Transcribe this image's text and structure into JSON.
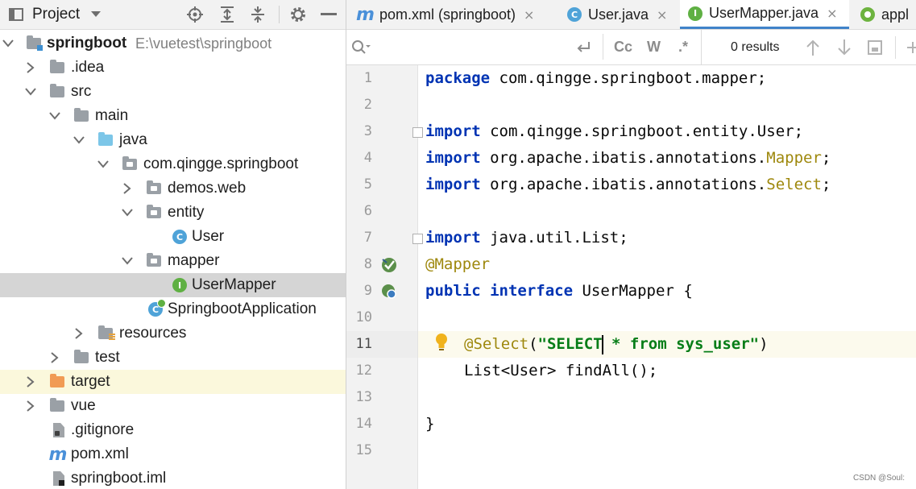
{
  "project_panel": {
    "title": "Project",
    "tree": [
      {
        "label": "springboot",
        "path": "E:\\vuetest\\springboot"
      },
      {
        "label": ".idea"
      },
      {
        "label": "src"
      },
      {
        "label": "main"
      },
      {
        "label": "java"
      },
      {
        "label": "com.qingge.springboot"
      },
      {
        "label": "demos.web"
      },
      {
        "label": "entity"
      },
      {
        "label": "User"
      },
      {
        "label": "mapper"
      },
      {
        "label": "UserMapper"
      },
      {
        "label": "SpringbootApplication"
      },
      {
        "label": "resources"
      },
      {
        "label": "test"
      },
      {
        "label": "target"
      },
      {
        "label": "vue"
      },
      {
        "label": ".gitignore"
      },
      {
        "label": "pom.xml"
      },
      {
        "label": "springboot.iml"
      }
    ]
  },
  "editor": {
    "tabs": [
      {
        "label": "pom.xml (springboot)",
        "close": "×"
      },
      {
        "label": "User.java",
        "close": "×"
      },
      {
        "label": "UserMapper.java",
        "close": "×"
      },
      {
        "label": "appl"
      }
    ],
    "search": {
      "placeholder": "",
      "match_case": "Cc",
      "words": "W",
      "regex": ".*",
      "results": "0 results"
    },
    "line_numbers": [
      "1",
      "2",
      "3",
      "4",
      "5",
      "6",
      "7",
      "8",
      "9",
      "10",
      "11",
      "12",
      "13",
      "14",
      "15"
    ],
    "code": {
      "l1": {
        "kw": "package",
        "rest": " com.qingge.springboot.mapper;"
      },
      "l3": {
        "kw": "import",
        "rest": " com.qingge.springboot.entity.User;"
      },
      "l4": {
        "kw": "import",
        "rest": " org.apache.ibatis.annotations.",
        "ann": "Mapper",
        "end": ";"
      },
      "l5": {
        "kw": "import",
        "rest": " org.apache.ibatis.annotations.",
        "ann": "Select",
        "end": ";"
      },
      "l7": {
        "kw": "import",
        "rest": " java.util.List;"
      },
      "l8": {
        "ann": "@Mapper"
      },
      "l9": {
        "kw1": "public",
        "kw2": "interface",
        "rest": " UserMapper {"
      },
      "l11": {
        "ann": "@Select",
        "open": "(",
        "str1": "\"SELECT",
        "str2": " * from sys_user\"",
        "close": ")"
      },
      "l12": {
        "text": "List<User> findAll();"
      },
      "l14": {
        "text": "}"
      }
    },
    "active_line": "11"
  },
  "watermark": "CSDN @Soul:",
  "colors": {
    "keyword": "#0033b3",
    "annotation": "#9e880d",
    "string": "#067d17",
    "accent": "#4083c9"
  }
}
